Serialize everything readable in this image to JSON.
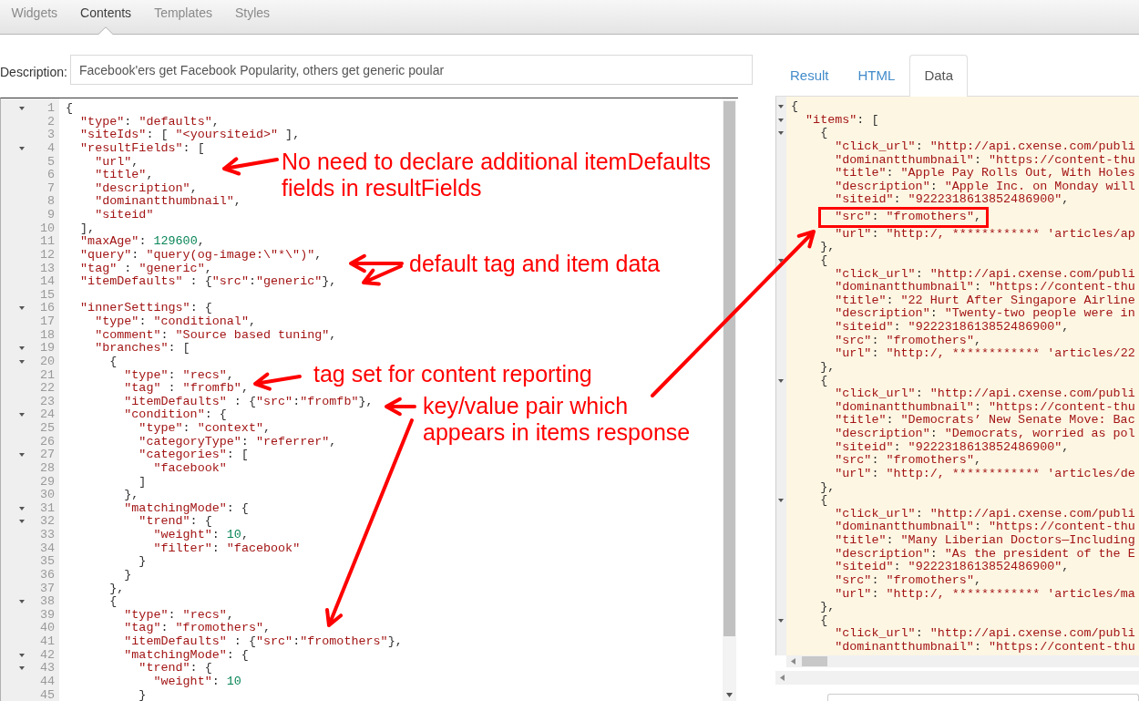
{
  "top_tabs": [
    {
      "label": "Widgets",
      "selected": false
    },
    {
      "label": "Contents",
      "selected": true
    },
    {
      "label": "Templates",
      "selected": false
    },
    {
      "label": "Styles",
      "selected": false
    }
  ],
  "description": {
    "label": "Description:",
    "value": "Facebook'ers get Facebook Popularity, others get generic poular"
  },
  "editor": {
    "lines": [
      {
        "number": "1",
        "text": "{",
        "foldable": true
      },
      {
        "number": "2",
        "text": "  \"type\": \"defaults\",",
        "foldable": false
      },
      {
        "number": "3",
        "text": "  \"siteIds\": [ \"<yoursiteid>\" ],",
        "foldable": false
      },
      {
        "number": "4",
        "text": "  \"resultFields\": [",
        "foldable": true
      },
      {
        "number": "5",
        "text": "    \"url\",",
        "foldable": false
      },
      {
        "number": "6",
        "text": "    \"title\",",
        "foldable": false
      },
      {
        "number": "7",
        "text": "    \"description\",",
        "foldable": false
      },
      {
        "number": "8",
        "text": "    \"dominantthumbnail\",",
        "foldable": false
      },
      {
        "number": "9",
        "text": "    \"siteid\"",
        "foldable": false
      },
      {
        "number": "10",
        "text": "  ],",
        "foldable": false
      },
      {
        "number": "11",
        "text": "  \"maxAge\": 129600,",
        "foldable": false
      },
      {
        "number": "12",
        "text": "  \"query\": \"query(og-image:\\\"*\\\")\",",
        "foldable": false
      },
      {
        "number": "13",
        "text": "  \"tag\" : \"generic\",",
        "foldable": false
      },
      {
        "number": "14",
        "text": "  \"itemDefaults\" : {\"src\":\"generic\"},",
        "foldable": false
      },
      {
        "number": "15",
        "foldable": false
      },
      {
        "number": "16",
        "text": "  \"innerSettings\": {",
        "foldable": true
      },
      {
        "number": "17",
        "text": "    \"type\": \"conditional\",",
        "foldable": false
      },
      {
        "number": "18",
        "text": "    \"comment\": \"Source based tuning\",",
        "foldable": false
      },
      {
        "number": "19",
        "text": "    \"branches\": [",
        "foldable": true
      },
      {
        "number": "20",
        "text": "      {",
        "foldable": true
      },
      {
        "number": "21",
        "text": "        \"type\": \"recs\",",
        "foldable": false
      },
      {
        "number": "22",
        "text": "        \"tag\" : \"fromfb\",",
        "foldable": false
      },
      {
        "number": "23",
        "text": "        \"itemDefaults\" : {\"src\":\"fromfb\"},",
        "foldable": false
      },
      {
        "number": "24",
        "text": "        \"condition\": {",
        "foldable": true
      },
      {
        "number": "25",
        "text": "          \"type\": \"context\",",
        "foldable": false
      },
      {
        "number": "26",
        "text": "          \"categoryType\": \"referrer\",",
        "foldable": false
      },
      {
        "number": "27",
        "text": "          \"categories\": [",
        "foldable": true
      },
      {
        "number": "28",
        "text": "            \"facebook\"",
        "foldable": false
      },
      {
        "number": "29",
        "text": "          ]",
        "foldable": false
      },
      {
        "number": "30",
        "text": "        },",
        "foldable": false
      },
      {
        "number": "31",
        "text": "        \"matchingMode\": {",
        "foldable": true
      },
      {
        "number": "32",
        "text": "          \"trend\": {",
        "foldable": true
      },
      {
        "number": "33",
        "text": "            \"weight\": 10,",
        "foldable": false
      },
      {
        "number": "34",
        "text": "            \"filter\": \"facebook\"",
        "foldable": false
      },
      {
        "number": "35",
        "text": "          }",
        "foldable": false
      },
      {
        "number": "36",
        "text": "        }",
        "foldable": false
      },
      {
        "number": "37",
        "text": "      },",
        "foldable": false
      },
      {
        "number": "38",
        "text": "      {",
        "foldable": true
      },
      {
        "number": "39",
        "text": "        \"type\": \"recs\",",
        "foldable": false
      },
      {
        "number": "40",
        "text": "        \"tag\": \"fromothers\",",
        "foldable": false
      },
      {
        "number": "41",
        "text": "        \"itemDefaults\" : {\"src\":\"fromothers\"},",
        "foldable": false
      },
      {
        "number": "42",
        "text": "        \"matchingMode\": {",
        "foldable": true
      },
      {
        "number": "43",
        "text": "          \"trend\": {",
        "foldable": true
      },
      {
        "number": "44",
        "text": "            \"weight\": 10",
        "foldable": false
      },
      {
        "number": "45",
        "text": "          }",
        "foldable": false
      }
    ]
  },
  "preview_tabs": [
    {
      "label": "Result",
      "selected": false
    },
    {
      "label": "HTML",
      "selected": false
    },
    {
      "label": "Data",
      "selected": true
    }
  ],
  "data_panel": {
    "lines": [
      {
        "text": "{",
        "foldable": true,
        "boxed": false
      },
      {
        "text": "  \"items\": [",
        "foldable": true,
        "boxed": false
      },
      {
        "text": "    {",
        "foldable": true,
        "boxed": false
      },
      {
        "text": "      \"click_url\": \"http://api.cxense.com/publi",
        "foldable": false,
        "boxed": false
      },
      {
        "text": "      \"dominantthumbnail\": \"https://content-thu",
        "foldable": false,
        "boxed": false
      },
      {
        "text": "      \"title\": \"Apple Pay Rolls Out, With Holes",
        "foldable": false,
        "boxed": false
      },
      {
        "text": "      \"description\": \"Apple Inc. on Monday will",
        "foldable": false,
        "boxed": false
      },
      {
        "text": "      \"siteid\": \"9222318613852486900\",",
        "foldable": false,
        "boxed": false
      },
      {
        "text": "      \"src\": \"fromothers\",",
        "foldable": false,
        "boxed": true
      },
      {
        "text": "      \"url\": \"http:/, ************ 'articles/ap",
        "foldable": false,
        "boxed": false
      },
      {
        "text": "    },",
        "foldable": false,
        "boxed": false
      },
      {
        "text": "    {",
        "foldable": true,
        "boxed": false
      },
      {
        "text": "      \"click_url\": \"http://api.cxense.com/publi",
        "foldable": false,
        "boxed": false
      },
      {
        "text": "      \"dominantthumbnail\": \"https://content-thu",
        "foldable": false,
        "boxed": false
      },
      {
        "text": "      \"title\": \"22 Hurt After Singapore Airline",
        "foldable": false,
        "boxed": false
      },
      {
        "text": "      \"description\": \"Twenty-two people were in",
        "foldable": false,
        "boxed": false
      },
      {
        "text": "      \"siteid\": \"9222318613852486900\",",
        "foldable": false,
        "boxed": false
      },
      {
        "text": "      \"src\": \"fromothers\",",
        "foldable": false,
        "boxed": false
      },
      {
        "text": "      \"url\": \"http:/, ************ 'articles/22",
        "foldable": false,
        "boxed": false
      },
      {
        "text": "    },",
        "foldable": false,
        "boxed": false
      },
      {
        "text": "    {",
        "foldable": true,
        "boxed": false
      },
      {
        "text": "      \"click_url\": \"http://api.cxense.com/publi",
        "foldable": false,
        "boxed": false
      },
      {
        "text": "      \"dominantthumbnail\": \"https://content-thu",
        "foldable": false,
        "boxed": false
      },
      {
        "text": "      \"title\": \"Democrats’ New Senate Move: Bac",
        "foldable": false,
        "boxed": false
      },
      {
        "text": "      \"description\": \"Democrats, worried as pol",
        "foldable": false,
        "boxed": false
      },
      {
        "text": "      \"siteid\": \"9222318613852486900\",",
        "foldable": false,
        "boxed": false
      },
      {
        "text": "      \"src\": \"fromothers\",",
        "foldable": false,
        "boxed": false
      },
      {
        "text": "      \"url\": \"http:/, ************ 'articles/de",
        "foldable": false,
        "boxed": false
      },
      {
        "text": "    },",
        "foldable": false,
        "boxed": false
      },
      {
        "text": "    {",
        "foldable": true,
        "boxed": false
      },
      {
        "text": "      \"click_url\": \"http://api.cxense.com/publi",
        "foldable": false,
        "boxed": false
      },
      {
        "text": "      \"dominantthumbnail\": \"https://content-thu",
        "foldable": false,
        "boxed": false
      },
      {
        "text": "      \"title\": \"Many Liberian Doctors—Including",
        "foldable": false,
        "boxed": false
      },
      {
        "text": "      \"description\": \"As the president of the E",
        "foldable": false,
        "boxed": false
      },
      {
        "text": "      \"siteid\": \"9222318613852486900\",",
        "foldable": false,
        "boxed": false
      },
      {
        "text": "      \"src\": \"fromothers\",",
        "foldable": false,
        "boxed": false
      },
      {
        "text": "      \"url\": \"http:/, ************ 'articles/ma",
        "foldable": false,
        "boxed": false
      },
      {
        "text": "    },",
        "foldable": false,
        "boxed": false
      },
      {
        "text": "    {",
        "foldable": true,
        "boxed": false
      },
      {
        "text": "      \"click_url\": \"http://api.cxense.com/publi",
        "foldable": false,
        "boxed": false
      },
      {
        "text": "      \"dominantthumbnail\": \"https://content-thu",
        "foldable": false,
        "boxed": false
      }
    ]
  },
  "annotations": [
    {
      "text": "No need to declare additional itemDefaults fields in resultFields"
    },
    {
      "text": "default tag and item data"
    },
    {
      "text": "tag set for content reporting"
    },
    {
      "text": "key/value pair which appears in items response"
    }
  ]
}
